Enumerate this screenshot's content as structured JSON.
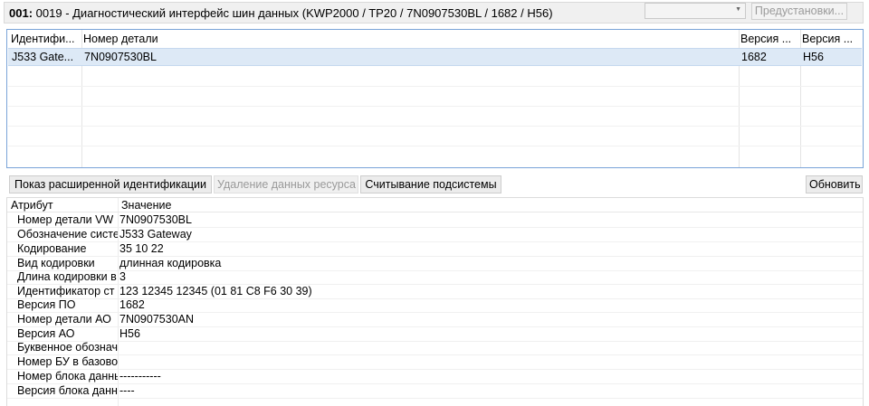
{
  "header": {
    "address": "001:",
    "title": "0019 - Диагностический интерфейс шин данных  (KWP2000 / TP20 / 7N0907530BL / 1682 / H56)",
    "combo_value": "",
    "presets_button": "Предустановки..."
  },
  "module_table": {
    "columns": [
      "Идентифи...",
      "Номер детали",
      "Версия ...",
      "Версия ..."
    ],
    "rows": [
      [
        "J533  Gate...",
        "7N0907530BL",
        "1682",
        "H56"
      ]
    ]
  },
  "toolbar": {
    "ext_ident": "Показ расширенной идентификации",
    "delete_resource": "Удаление данных ресурса",
    "read_subsystems": "Считывание подсистемы",
    "refresh": "Обновить"
  },
  "attributes": {
    "col_attr": "Атрибут",
    "col_value": "Значение",
    "rows": [
      {
        "name": "Номер детали VW",
        "value": "7N0907530BL"
      },
      {
        "name": "Обозначение системы",
        "value": "J533  Gateway"
      },
      {
        "name": "Кодирование",
        "value": "35 10 22"
      },
      {
        "name": "Вид кодировки",
        "value": "длинная кодировка"
      },
      {
        "name": "Длина кодировки в",
        "value": "3"
      },
      {
        "name": "Идентификатор ст",
        "value": "123 12345 12345 (01 81 C8 F6 30 39)"
      },
      {
        "name": "Версия ПО",
        "value": "1682"
      },
      {
        "name": "Номер детали АО",
        "value": "7N0907530AN"
      },
      {
        "name": "Версия АО",
        "value": "H56"
      },
      {
        "name": "Буквенное обознач",
        "value": ""
      },
      {
        "name": "Номер БУ в базово",
        "value": ""
      },
      {
        "name": "Номер блока данных",
        "value": "-----------"
      },
      {
        "name": "Версия блока данных",
        "value": "----"
      }
    ]
  }
}
